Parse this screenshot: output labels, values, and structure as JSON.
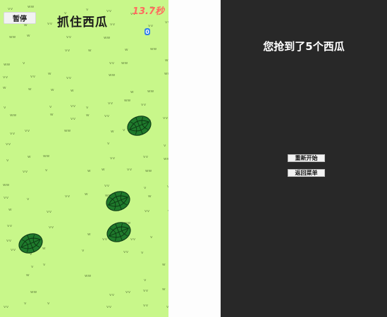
{
  "game": {
    "pause_label": "暂停",
    "title": "抓住西瓜",
    "timer": "13.7秒",
    "score": "0",
    "background_color": "#c8f78a",
    "item_icon": "watermelon-icon"
  },
  "result": {
    "message": "您抢到了5个西瓜",
    "restart_label": "重新开始",
    "menu_label": "返回菜单",
    "background_color": "#282828"
  }
}
